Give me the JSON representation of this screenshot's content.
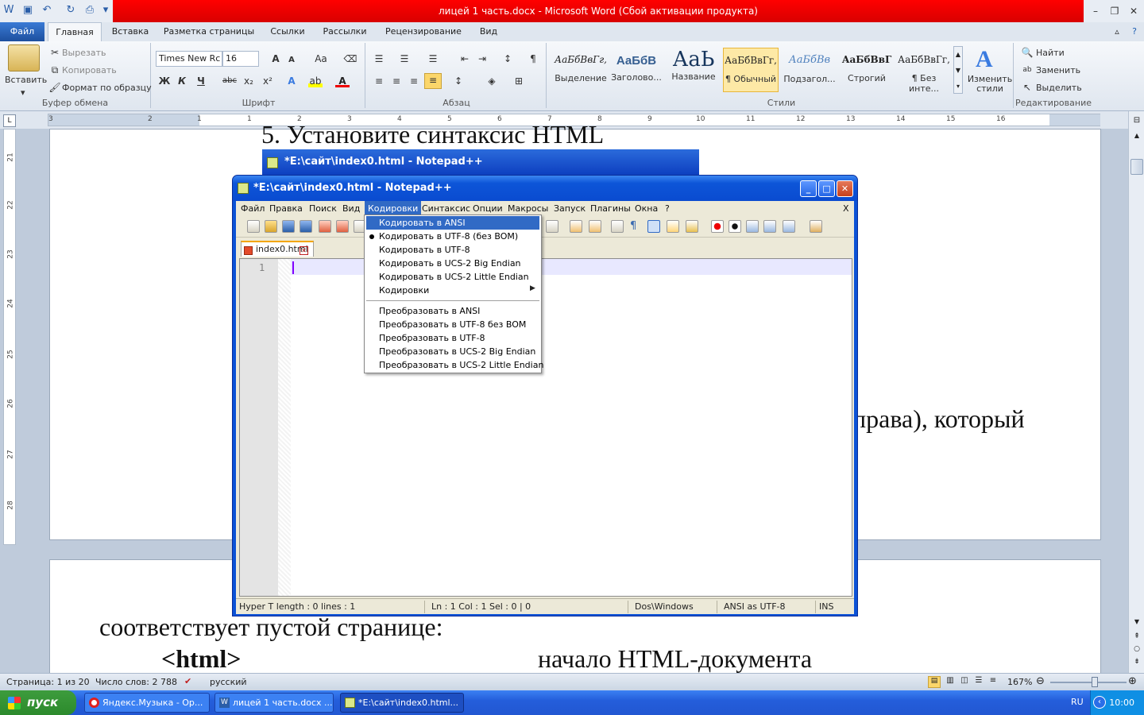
{
  "word": {
    "title": "лицей 1 часть.docx  -  Microsoft Word (Сбой активации продукта)",
    "tabs": [
      "Файл",
      "Главная",
      "Вставка",
      "Разметка страницы",
      "Ссылки",
      "Рассылки",
      "Рецензирование",
      "Вид"
    ],
    "clipboard": {
      "paste": "Вставить",
      "cut": "Вырезать",
      "copy": "Копировать",
      "format_painter": "Формат по образцу",
      "label": "Буфер обмена"
    },
    "font": {
      "name": "Times New Rc",
      "size": "16",
      "label": "Шрифт",
      "bold": "Ж",
      "italic": "К",
      "underline": "Ч",
      "strike": "abc",
      "sub": "x₂",
      "sup": "x²",
      "grow": "A",
      "shrink": "A",
      "case": "Aa"
    },
    "paragraph": {
      "label": "Абзац",
      "pilcrow": "¶"
    },
    "styles": {
      "label": "Стили",
      "items": [
        {
          "sample": "АаБбВвГг,",
          "name": "Выделение"
        },
        {
          "sample": "АаБбВ",
          "name": "Заголово..."
        },
        {
          "sample": "АаЬ",
          "name": "Название"
        },
        {
          "sample": "АаБбВвГг,",
          "name": "¶ Обычный"
        },
        {
          "sample": "АаБбВв",
          "name": "Подзагол..."
        },
        {
          "sample": "АаБбВвГ",
          "name": "Строгий"
        },
        {
          "sample": "АаБбВвГг,",
          "name": "¶ Без инте..."
        }
      ],
      "change": "Изменить стили"
    },
    "editing": {
      "label": "Редактирование",
      "find": "Найти",
      "replace": "Заменить",
      "select": "Выделить"
    },
    "ruler_numbers": [
      "3",
      "1",
      "2",
      "1",
      "1",
      "2",
      "3",
      "4",
      "5",
      "6",
      "7",
      "8",
      "9",
      "10",
      "11",
      "12",
      "13",
      "14",
      "15",
      "16"
    ],
    "vruler_numbers": [
      "21",
      "22",
      "23",
      "24",
      "25",
      "26",
      "27",
      "28"
    ],
    "doc": {
      "heading": "5. Установите синтаксис HTML",
      "right_text": "права), который",
      "text2": "соответствует пустой странице:",
      "tag": "<html>",
      "comment": "начало HTML-документа"
    },
    "status": {
      "page": "Страница: 1 из 20",
      "words": "Число слов: 2 788",
      "lang": "русский",
      "zoom": "167%"
    }
  },
  "notepad": {
    "bg_title": "*E:\\сайт\\index0.html - Notepad++",
    "title": "*E:\\сайт\\index0.html - Notepad++",
    "menu": [
      "Файл",
      "Правка",
      "Поиск",
      "Вид",
      "Кодировки",
      "Синтаксис",
      "Опции",
      "Макросы",
      "Запуск",
      "Плагины",
      "Окна",
      "?"
    ],
    "menu_close": "X",
    "tab": "index0.html",
    "line_number": "1",
    "status": {
      "length": "Hyper T length : 0    lines : 1",
      "pos": "Ln : 1    Col : 1    Sel : 0 | 0",
      "eol": "Dos\\Windows",
      "enc": "ANSI as UTF-8",
      "mode": "INS"
    }
  },
  "encoding_menu": {
    "group1": [
      "Кодировать в ANSI",
      "Кодировать в UTF-8 (без BOM)",
      "Кодировать в UTF-8",
      "Кодировать в UCS-2 Big Endian",
      "Кодировать в UCS-2 Little Endian",
      "Кодировки"
    ],
    "group2": [
      "Преобразовать в ANSI",
      "Преобразовать в UTF-8 без BOM",
      "Преобразовать в UTF-8",
      "Преобразовать в UCS-2 Big Endian",
      "Преобразовать в UCS-2 Little Endian"
    ],
    "highlighted": "Кодировать в ANSI",
    "checked": "Кодировать в UTF-8 (без BOM)"
  },
  "taskbar": {
    "start": "пуск",
    "buttons": [
      "Яндекс.Музыка - Op...",
      "лицей 1 часть.docx ...",
      "*E:\\сайт\\index0.html..."
    ],
    "lang": "RU",
    "clock": "10:00"
  }
}
